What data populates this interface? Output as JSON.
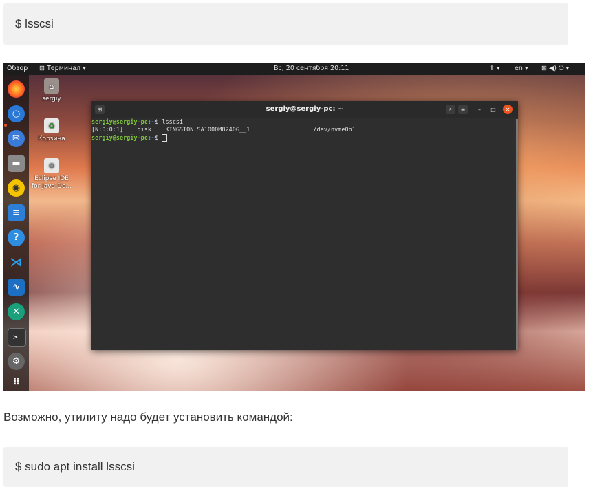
{
  "article": {
    "cmd1": "$  lsscsi",
    "paragraph": "Возможно, утилиту надо будет установить командой:",
    "cmd2": "$ sudo apt install lsscsi"
  },
  "topbar": {
    "overview": "Обзор",
    "app_menu": "Терминал ▾",
    "clock": "Вс, 20 сентября  20:11",
    "lang": "en ▾",
    "status_icons": "⊞ ◀) ⏻ ▾",
    "accessibility": "✝ ▾"
  },
  "desktop": {
    "home_label": "sergiy",
    "trash_label": "Корзина",
    "eclipse_label": "Eclipse IDE for Java De..."
  },
  "dock": {
    "icons": [
      "firefox-icon",
      "chrome-icon",
      "thunderbird-icon",
      "files-icon",
      "rhythmbox-icon",
      "libreoffice-writer-icon",
      "help-icon",
      "vscode-icon",
      "system-monitor-icon",
      "crossover-icon",
      "terminal-icon",
      "settings-icon",
      "apps-grid-icon"
    ]
  },
  "terminal": {
    "title": "sergiy@sergiy-pc: ~",
    "line1_user": "sergiy@sergiy-pc",
    "line1_path": ":~",
    "line1_cmd": "$ lsscsi",
    "line2": "[N:0:0:1]    disk    KINGSTON SA1000M8240G__1                  /dev/nvme0n1",
    "line3_user": "sergiy@sergiy-pc",
    "line3_path": ":~",
    "line3_cmd": "$ "
  },
  "colors": {
    "dock_active": "#e9541f",
    "prompt_user": "#7ec53a",
    "prompt_path": "#6b9bd8",
    "close_button": "#e9541f"
  }
}
